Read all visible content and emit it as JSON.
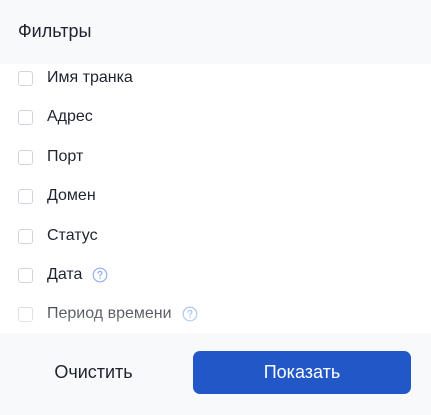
{
  "header": {
    "title": "Фильтры"
  },
  "filters": [
    {
      "label": "Имя транка",
      "checked": false,
      "has_help": false
    },
    {
      "label": "Адрес",
      "checked": false,
      "has_help": false
    },
    {
      "label": "Порт",
      "checked": false,
      "has_help": false
    },
    {
      "label": "Домен",
      "checked": false,
      "has_help": false
    },
    {
      "label": "Статус",
      "checked": false,
      "has_help": false
    },
    {
      "label": "Дата",
      "checked": false,
      "has_help": true
    },
    {
      "label": "Период времени",
      "checked": false,
      "has_help": true
    }
  ],
  "footer": {
    "clear_label": "Очистить",
    "show_label": "Показать"
  },
  "colors": {
    "primary": "#2257c8",
    "help_icon": "#8fb2ea",
    "panel_bg": "#f8f9fb"
  }
}
